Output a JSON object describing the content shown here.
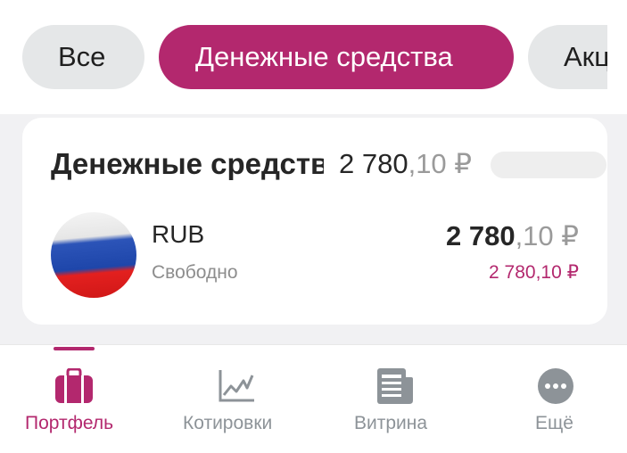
{
  "filters": {
    "all": "Все",
    "cash": "Денежные средства",
    "stocks": "Акции"
  },
  "card": {
    "title": "Денежные средства",
    "total_int": "2 780",
    "total_frac": ",10 ₽",
    "currency": {
      "code": "RUB",
      "status": "Свободно",
      "amount_int": "2 780",
      "amount_frac": ",10 ₽",
      "free_amount": "2 780,10 ₽",
      "flag_icon": "russia-flag-icon"
    }
  },
  "nav": {
    "portfolio": "Портфель",
    "quotes": "Котировки",
    "showcase": "Витрина",
    "more": "Ещё"
  },
  "colors": {
    "accent": "#b3286e",
    "pill_inactive": "#e5e7e8",
    "nav_inactive": "#8d9398"
  }
}
